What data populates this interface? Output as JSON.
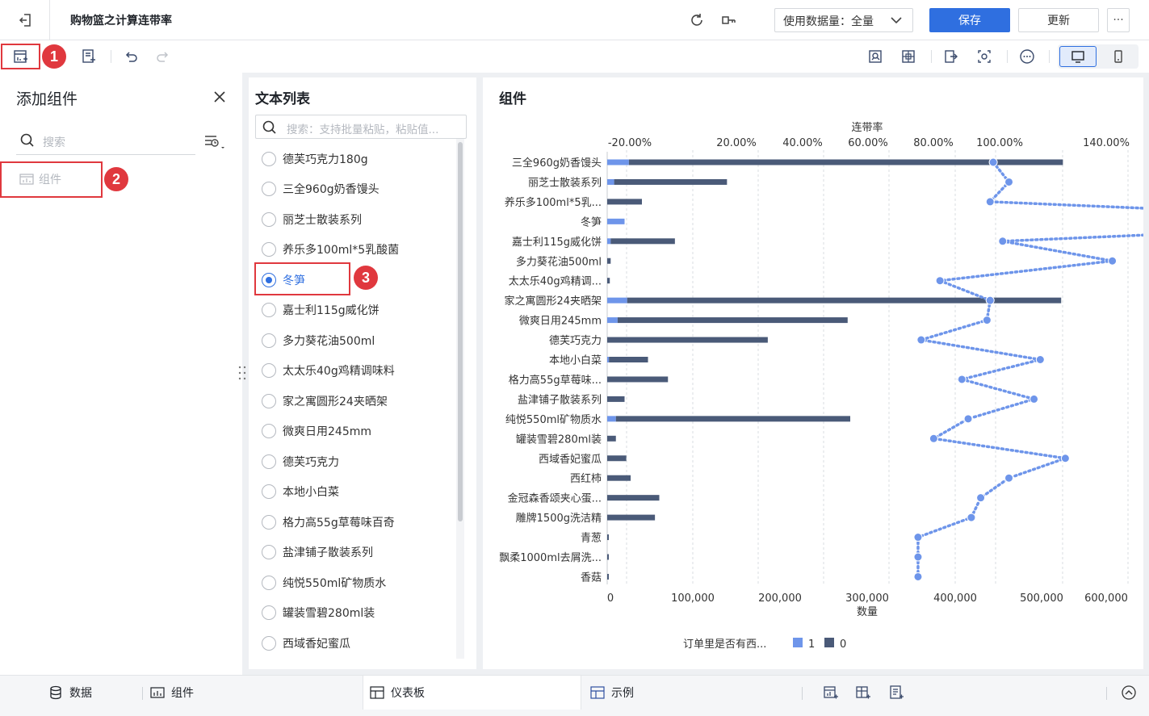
{
  "header": {
    "title": "购物篮之计算连带率",
    "data_select": "使用数据量：全量",
    "save_label": "保存",
    "update_label": "更新",
    "more_label": "···"
  },
  "badges": {
    "b1": "1",
    "b2": "2",
    "b3": "3"
  },
  "left_panel": {
    "title": "添加组件",
    "search_placeholder": "搜索",
    "component_label": "组件"
  },
  "list_panel": {
    "title": "文本列表",
    "search_placeholder": "搜索：支持批量粘贴，粘贴值...",
    "items": [
      "德芙巧克力180g",
      "三全960g奶香馒头",
      "丽芝士散装系列",
      "养乐多100ml*5乳酸菌",
      "冬笋",
      "嘉士利115g威化饼",
      "多力葵花油500ml",
      "太太乐40g鸡精调味料",
      "家之寓圆形24夹晒架",
      "微爽日用245mm",
      "德芙巧克力",
      "本地小白菜",
      "格力高55g草莓味百奇",
      "盐津铺子散装系列",
      "纯悦550ml矿物质水",
      "罐装雪碧280ml装",
      "西域香妃蜜瓜"
    ],
    "selected_index": 4
  },
  "chart_panel": {
    "title": "组件"
  },
  "chart_data": {
    "type": "bar",
    "categories": [
      "三全960g奶香馒头",
      "丽芝士散装系列",
      "养乐多100ml*5乳...",
      "冬笋",
      "嘉士利115g威化饼",
      "多力葵花油500ml",
      "太太乐40g鸡精调...",
      "家之寓圆形24夹晒架",
      "微爽日用245mm",
      "德芙巧克力",
      "本地小白菜",
      "格力高55g草莓味...",
      "盐津铺子散装系列",
      "纯悦550ml矿物质水",
      "罐装雪碧280ml装",
      "西域香妃蜜瓜",
      "西红柿",
      "金冠森香颂夹心蛋...",
      "雕牌1500g洗洁精",
      "青葱",
      "飘柔1000ml去屑洗...",
      "香菇"
    ],
    "series": [
      {
        "name": "1",
        "color": "#6e95ea",
        "values": [
          25000,
          8000,
          0,
          20000,
          4000,
          0,
          0,
          23000,
          12000,
          0,
          2000,
          0,
          0,
          10000,
          0,
          0,
          0,
          0,
          0,
          0,
          0,
          0
        ]
      },
      {
        "name": "0",
        "color": "#4a5a78",
        "values": [
          500000,
          130000,
          40000,
          0,
          74000,
          4000,
          3000,
          500000,
          265000,
          185000,
          45000,
          70000,
          20000,
          270000,
          10000,
          22000,
          27000,
          60000,
          55000,
          1000,
          1000,
          1000
        ]
      }
    ],
    "line": {
      "name": "连带率",
      "values": [
        0.97,
        1.02,
        0.96,
        2.45,
        1.0,
        1.35,
        0.8,
        0.96,
        0.95,
        0.74,
        1.12,
        0.87,
        1.1,
        0.89,
        0.78,
        1.2,
        1.02,
        0.93,
        0.9,
        0.73,
        0.73,
        0.73
      ]
    },
    "x_ticks": [
      "0",
      "100,000",
      "200,000",
      "300,000",
      "400,000",
      "500,000",
      "600,000"
    ],
    "xlim": [
      0,
      600000
    ],
    "xlabel": "数量",
    "top_ticks": [
      "-20.00%",
      "20.00%",
      "40.00%",
      "60.00%",
      "80.00%",
      "100.00%",
      "140.00%"
    ],
    "top_label": "连带率",
    "legend_title": "订单里是否有西...",
    "legend_items": [
      "1",
      "0"
    ]
  },
  "bottom": {
    "tab_data": "数据",
    "tab_component": "组件",
    "tab_dashboard": "仪表板",
    "tab_example": "示例"
  }
}
